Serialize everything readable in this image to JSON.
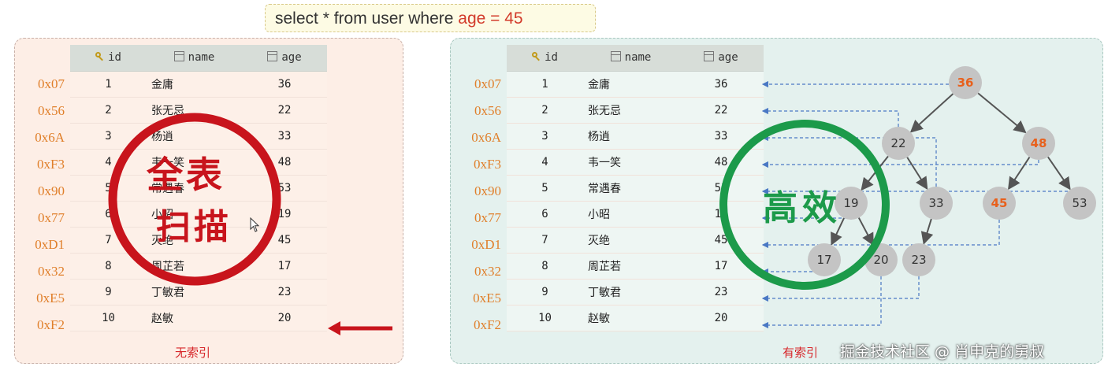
{
  "query": {
    "prefix": "select * from user where ",
    "highlight": "age = 45"
  },
  "table": {
    "headers": {
      "id": "id",
      "name": "name",
      "age": "age"
    },
    "rows": [
      {
        "addr": "0x07",
        "id": "1",
        "name": "金庸",
        "age": "36"
      },
      {
        "addr": "0x56",
        "id": "2",
        "name": "张无忌",
        "age": "22"
      },
      {
        "addr": "0x6A",
        "id": "3",
        "name": "杨逍",
        "age": "33"
      },
      {
        "addr": "0xF3",
        "id": "4",
        "name": "韦一笑",
        "age": "48"
      },
      {
        "addr": "0x90",
        "id": "5",
        "name": "常遇春",
        "age": "53"
      },
      {
        "addr": "0x77",
        "id": "6",
        "name": "小昭",
        "age": "19"
      },
      {
        "addr": "0xD1",
        "id": "7",
        "name": "灭绝",
        "age": "45"
      },
      {
        "addr": "0x32",
        "id": "8",
        "name": "周芷若",
        "age": "17"
      },
      {
        "addr": "0xE5",
        "id": "9",
        "name": "丁敏君",
        "age": "23"
      },
      {
        "addr": "0xF2",
        "id": "10",
        "name": "赵敏",
        "age": "20"
      }
    ]
  },
  "left": {
    "caption": "无索引",
    "stamp": {
      "line1": "全表",
      "line2": "扫描",
      "color": "#c8141c"
    }
  },
  "right": {
    "caption": "有索引",
    "stamp": {
      "text": "高效",
      "color": "#1c9a4a"
    },
    "tree": {
      "nodes": [
        {
          "key": "n36",
          "label": "36",
          "highlight": true
        },
        {
          "key": "n22",
          "label": "22",
          "highlight": false
        },
        {
          "key": "n48",
          "label": "48",
          "highlight": true
        },
        {
          "key": "n19",
          "label": "19",
          "highlight": false
        },
        {
          "key": "n33",
          "label": "33",
          "highlight": false
        },
        {
          "key": "n45",
          "label": "45",
          "highlight": true
        },
        {
          "key": "n53",
          "label": "53",
          "highlight": false
        },
        {
          "key": "n17",
          "label": "17",
          "highlight": false
        },
        {
          "key": "n20",
          "label": "20",
          "highlight": false
        },
        {
          "key": "n23",
          "label": "23",
          "highlight": false
        }
      ],
      "highlight_color": "#e8601c",
      "node_color": "#c4c4c4"
    }
  },
  "watermark": "掘金技术社区 @ 肖申克的舅叔"
}
